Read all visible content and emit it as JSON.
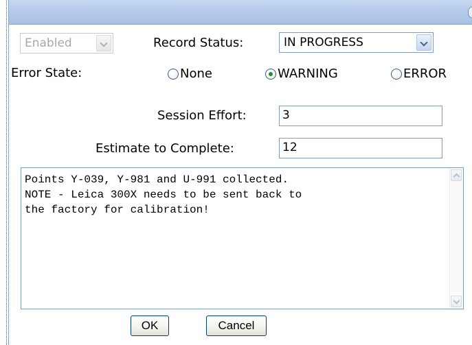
{
  "header": {
    "enabled_select": "Enabled"
  },
  "record_status": {
    "label": "Record Status:",
    "value": "IN PROGRESS"
  },
  "error_state": {
    "label": "Error State:",
    "options": [
      {
        "label": "None",
        "checked": false
      },
      {
        "label": "WARNING",
        "checked": true
      },
      {
        "label": "ERROR",
        "checked": false
      }
    ]
  },
  "session_effort": {
    "label": "Session Effort:",
    "value": "3"
  },
  "estimate": {
    "label": "Estimate to Complete:",
    "value": "12"
  },
  "notes": {
    "text": "Points Y-039, Y-981 and U-991 collected.\nNOTE - Leica 300X needs to be sent back to\nthe factory for calibration!"
  },
  "buttons": {
    "ok": "OK",
    "cancel": "Cancel"
  },
  "colors": {
    "titlebar": "#b5cbe9",
    "border": "#7f9db9",
    "radio_checked": "#2b8a2b"
  }
}
